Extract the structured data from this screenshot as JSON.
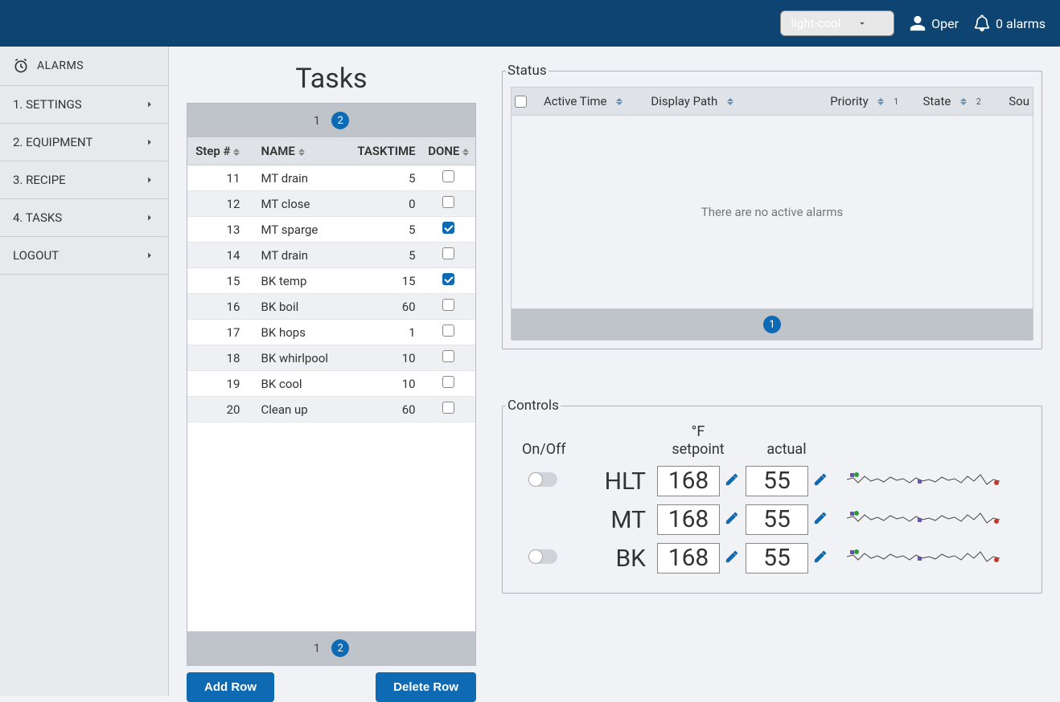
{
  "topbar": {
    "theme": "light-cool",
    "user": "Oper",
    "alarms_label": "0 alarms"
  },
  "sidebar": {
    "header": "ALARMS",
    "items": [
      {
        "label": "1. SETTINGS"
      },
      {
        "label": "2. EQUIPMENT"
      },
      {
        "label": "3. RECIPE"
      },
      {
        "label": "4. TASKS"
      },
      {
        "label": "LOGOUT"
      }
    ]
  },
  "page_title": "Tasks",
  "tasks_table": {
    "pager": {
      "pages": [
        "1",
        "2"
      ],
      "current": "2"
    },
    "columns": {
      "step": "Step #",
      "name": "NAME",
      "tasktime": "TASKTIME",
      "done": "DONE"
    },
    "rows": [
      {
        "step": "11",
        "name": "MT drain",
        "time": "5",
        "done": false
      },
      {
        "step": "12",
        "name": "MT close",
        "time": "0",
        "done": false
      },
      {
        "step": "13",
        "name": "MT sparge",
        "time": "5",
        "done": true
      },
      {
        "step": "14",
        "name": "MT drain",
        "time": "5",
        "done": false
      },
      {
        "step": "15",
        "name": "BK temp",
        "time": "15",
        "done": true
      },
      {
        "step": "16",
        "name": "BK boil",
        "time": "60",
        "done": false
      },
      {
        "step": "17",
        "name": "BK hops",
        "time": "1",
        "done": false
      },
      {
        "step": "18",
        "name": "BK whirlpool",
        "time": "10",
        "done": false
      },
      {
        "step": "19",
        "name": "BK cool",
        "time": "10",
        "done": false
      },
      {
        "step": "20",
        "name": "Clean up",
        "time": "60",
        "done": false
      }
    ],
    "buttons": {
      "add": "Add Row",
      "delete": "Delete Row"
    }
  },
  "status": {
    "legend": "Status",
    "columns": {
      "active_time": "Active Time",
      "display_path": "Display Path",
      "priority": "Priority",
      "priority_order": "1",
      "state": "State",
      "state_order": "2",
      "source": "Sou"
    },
    "empty": "There are no active alarms",
    "pager_current": "1"
  },
  "controls": {
    "legend": "Controls",
    "header": {
      "onoff": "On/Off",
      "unit": "°F",
      "setpoint": "setpoint",
      "actual": "actual"
    },
    "rows": [
      {
        "id": "HLT",
        "has_toggle": true,
        "setpoint": "168",
        "actual": "55"
      },
      {
        "id": "MT",
        "has_toggle": false,
        "setpoint": "168",
        "actual": "55"
      },
      {
        "id": "BK",
        "has_toggle": true,
        "setpoint": "168",
        "actual": "55"
      }
    ]
  }
}
